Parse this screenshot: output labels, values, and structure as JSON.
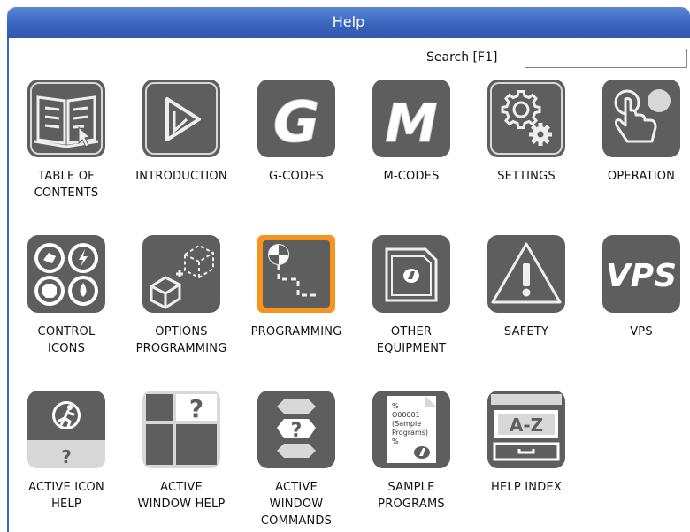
{
  "window": {
    "title": "Help"
  },
  "search": {
    "label": "Search [F1]",
    "value": "",
    "placeholder": ""
  },
  "tiles": [
    {
      "label": "TABLE OF\nCONTENTS"
    },
    {
      "label": "INTRODUCTION"
    },
    {
      "label": "G-CODES"
    },
    {
      "label": "M-CODES"
    },
    {
      "label": "SETTINGS"
    },
    {
      "label": "OPERATION"
    },
    {
      "label": "CONTROL\nICONS"
    },
    {
      "label": "OPTIONS\nPROGRAMMING"
    },
    {
      "label": "PROGRAMMING"
    },
    {
      "label": "OTHER\nEQUIPMENT"
    },
    {
      "label": "SAFETY"
    },
    {
      "label": "VPS"
    },
    {
      "label": "ACTIVE ICON\nHELP"
    },
    {
      "label": "ACTIVE\nWINDOW HELP"
    },
    {
      "label": "ACTIVE\nWINDOW\nCOMMANDS"
    },
    {
      "label": "SAMPLE\nPROGRAMS"
    },
    {
      "label": "HELP INDEX"
    }
  ],
  "icon_text": {
    "g_letter": "G",
    "m_letter": "M",
    "vps": "VPS",
    "question": "?",
    "az": "A-Z",
    "sample_lines": [
      "%",
      "O00001",
      "(Sample",
      "Programs)",
      "%"
    ]
  },
  "colors": {
    "title_bar": "#3a66bf",
    "icon_bg": "#5e5e5e",
    "selected_border": "#f7941d"
  }
}
